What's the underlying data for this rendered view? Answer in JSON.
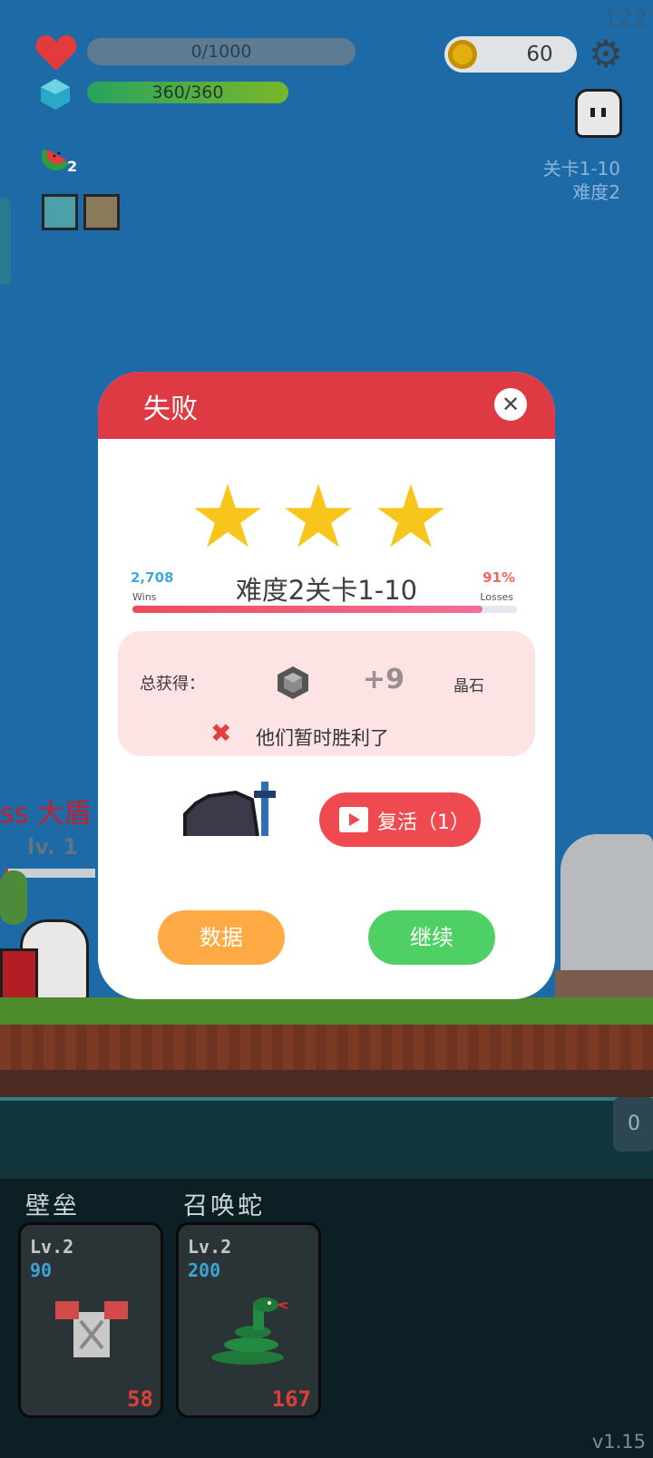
{
  "hud": {
    "fps": "122",
    "health": {
      "text": "0/1000",
      "fraction": 0.0
    },
    "mana": {
      "text": "360/360",
      "fraction": 1.0
    },
    "coins": "60",
    "watermelon_count": "2",
    "stage": "关卡1-10",
    "difficulty": "难度2"
  },
  "background": {
    "boss_name": "ss  大盾",
    "boss_level": "lv. 1"
  },
  "dialog": {
    "title": "失败",
    "close_icon": "close-icon",
    "stars": 3,
    "level_title": "难度2关卡1-10",
    "wins_value": "2,708",
    "wins_label": "Wins",
    "losses_value": "91%",
    "losses_label": "Losses",
    "win_rate_fraction": 0.91,
    "reward": {
      "label": "总获得：",
      "icon": "gem-icon",
      "amount": "+9",
      "unit": "晶石"
    },
    "result_text": "他们暂时胜利了",
    "revive_label": "复活（1）",
    "stats_button": "数据",
    "continue_button": "继续"
  },
  "cards": [
    {
      "name": "壁垒",
      "level": "Lv.2",
      "cost": "90",
      "count": "58",
      "icon": "armor-icon"
    },
    {
      "name": "召唤蛇",
      "level": "Lv.2",
      "cost": "200",
      "count": "167",
      "icon": "snake-icon"
    }
  ],
  "side_counter": "0",
  "version": "v1.15",
  "colors": {
    "dialog_header": "#de3a43",
    "star": "#f7c51b",
    "revive": "#ef4a4f",
    "stats": "#ffaa45",
    "continue": "#4ed064"
  }
}
